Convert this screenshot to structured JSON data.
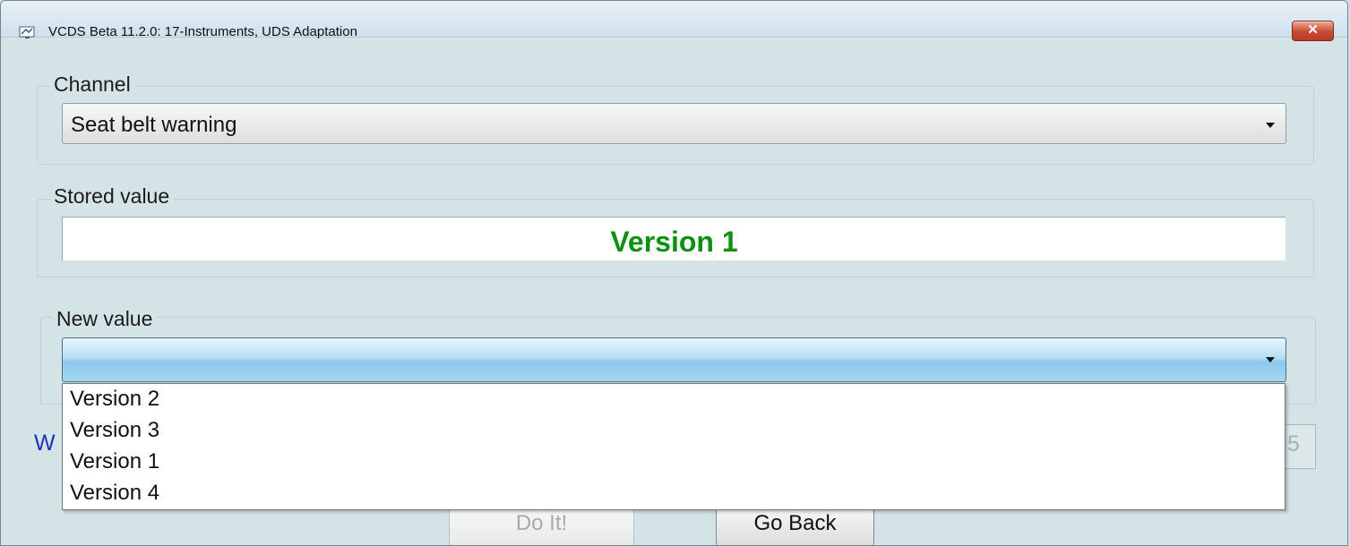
{
  "window": {
    "title": "VCDS Beta 11.2.0: 17-Instruments,  UDS Adaptation",
    "close_label": "✕"
  },
  "channel": {
    "legend": "Channel",
    "selected": "Seat belt warning"
  },
  "stored": {
    "legend": "Stored value",
    "value": "Version 1",
    "value_color": "#0d8f12"
  },
  "new_value": {
    "legend": "New value",
    "selected": "",
    "options": [
      "Version 2",
      "Version 3",
      "Version 1",
      "Version 4"
    ]
  },
  "partial": {
    "left_text": "W",
    "right_text": "5"
  },
  "buttons": {
    "do_it": "Do It!",
    "go_back": "Go Back"
  }
}
